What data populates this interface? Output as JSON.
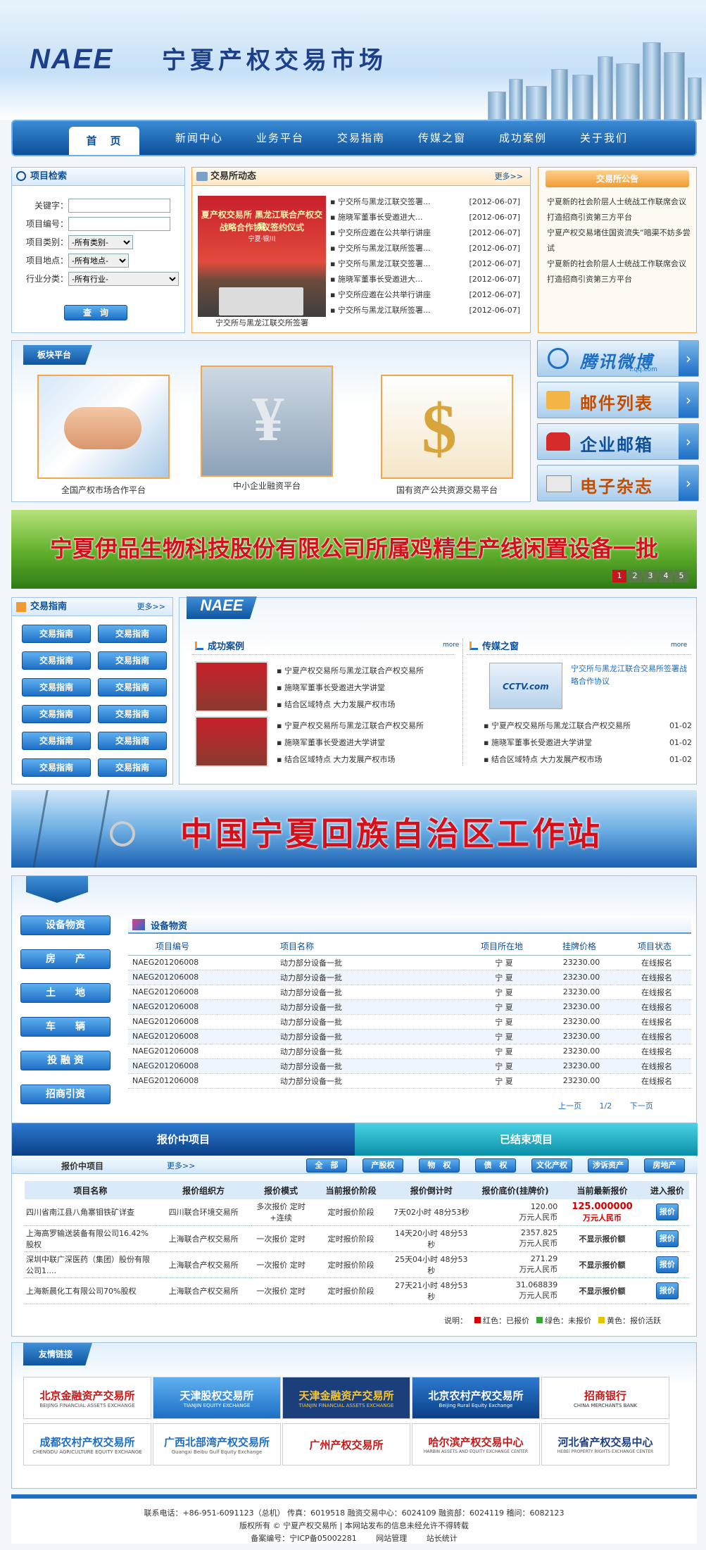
{
  "header": {
    "logo": "NAEE",
    "site_name": "宁夏产权交易市场"
  },
  "nav": {
    "items": [
      "首　页",
      "新闻中心",
      "业务平台",
      "交易指南",
      "传媒之窗",
      "成功案例",
      "关于我们"
    ]
  },
  "search": {
    "title": "项目检索",
    "fields": [
      {
        "label": "关键字：",
        "value": ""
      },
      {
        "label": "项目编号：",
        "value": ""
      },
      {
        "label": "项目类别：",
        "value": "-所有类别-"
      },
      {
        "label": "项目地点：",
        "value": "-所有地点-"
      },
      {
        "label": "行业分类：",
        "value": "-所有行业-"
      }
    ],
    "button": "查　询"
  },
  "news": {
    "title": "交易所动态",
    "more": "更多>>",
    "banner_title": "夏产权交易所  黑龙江联合产权交易",
    "banner_subtitle": "战略合作协议签约仪式",
    "banner_place": "宁夏·银川",
    "caption": "宁交所与黑龙江联交所签署",
    "items": [
      {
        "text": "宁交所与黑龙江联交签署...",
        "date": "[2012-06-07]"
      },
      {
        "text": "施晓军董事长受邀进大...",
        "date": "[2012-06-07]"
      },
      {
        "text": "宁交所应邀在公共举行讲座",
        "date": "[2012-06-07]"
      },
      {
        "text": "宁交所与黑龙江联所签署...",
        "date": "[2012-06-07]"
      },
      {
        "text": "宁交所与黑龙江联交签署...",
        "date": "[2012-06-07]"
      },
      {
        "text": "施晓军董事长受邀进大...",
        "date": "[2012-06-07]"
      },
      {
        "text": "宁交所应邀在公共举行讲座",
        "date": "[2012-06-07]"
      },
      {
        "text": "宁交所与黑龙江联所签署...",
        "date": "[2012-06-07]"
      }
    ]
  },
  "notice": {
    "title": "交易所公告",
    "items": [
      "宁夏新的社会阶层人士统战工作联席会议",
      "打造招商引资第三方平台",
      "宁夏产权交易堵住国资流失“暗渠不妨多尝试",
      "宁夏新的社会阶层人士统战工作联席会议",
      "打造招商引资第三方平台"
    ]
  },
  "platform": {
    "title": "板块平台",
    "items": [
      "全国产权市场合作平台",
      "中小企业融资平台",
      "国有资产公共资源交易平台"
    ]
  },
  "side_buttons": [
    {
      "label": "腾讯微博",
      "sub": "t.qq.com"
    },
    {
      "label": "邮件列表",
      "sub": ""
    },
    {
      "label": "企业邮箱",
      "sub": ""
    },
    {
      "label": "电子杂志",
      "sub": ""
    }
  ],
  "banner": {
    "text": "宁夏伊品生物科技股份有限公司所属鸡精生产线闲置设备一批",
    "pages": [
      "1",
      "2",
      "3",
      "4",
      "5"
    ]
  },
  "guide": {
    "title": "交易指南",
    "more": "更多>>",
    "buttons": [
      "交易指南",
      "交易指南",
      "交易指南",
      "交易指南",
      "交易指南",
      "交易指南",
      "交易指南",
      "交易指南",
      "交易指南",
      "交易指南",
      "交易指南",
      "交易指南"
    ]
  },
  "success": {
    "title": "成功案例",
    "more": "more",
    "items": [
      "宁夏产权交易所与黑龙江联合产权交易所",
      "施晓军董事长受邀进大学讲堂",
      "结合区域特点 大力发展产权市场",
      "宁夏产权交易所与黑龙江联合产权交易所",
      "施晓军董事长受邀进大学讲堂",
      "结合区域特点 大力发展产权市场"
    ]
  },
  "media": {
    "title": "传媒之窗",
    "more": "more",
    "feature": "宁交所与黑龙江联合交易所签署战略合作协议",
    "thumb_label": "CCTV.com",
    "items": [
      {
        "text": "宁夏产权交易所与黑龙江联合产权交易所",
        "date": "01-02"
      },
      {
        "text": "施晓军董事长受邀进大学讲堂",
        "date": "01-02"
      },
      {
        "text": "结合区域特点 大力发展产权市场",
        "date": "01-02"
      }
    ]
  },
  "station": {
    "text": "中国宁夏回族自治区工作站"
  },
  "categories": [
    "设备物资",
    "房　　产",
    "土　　地",
    "车　　辆",
    "投 融 资",
    "招商引资"
  ],
  "equipment": {
    "title": "设备物资",
    "headers": [
      "项目编号",
      "项目名称",
      "项目所在地",
      "挂牌价格",
      "项目状态"
    ],
    "rows": [
      [
        "NAEG201206008",
        "动力部分设备一批",
        "宁 夏",
        "23230.00",
        "在线报名"
      ],
      [
        "NAEG201206008",
        "动力部分设备一批",
        "宁 夏",
        "23230.00",
        "在线报名"
      ],
      [
        "NAEG201206008",
        "动力部分设备一批",
        "宁 夏",
        "23230.00",
        "在线报名"
      ],
      [
        "NAEG201206008",
        "动力部分设备一批",
        "宁 夏",
        "23230.00",
        "在线报名"
      ],
      [
        "NAEG201206008",
        "动力部分设备一批",
        "宁 夏",
        "23230.00",
        "在线报名"
      ],
      [
        "NAEG201206008",
        "动力部分设备一批",
        "宁 夏",
        "23230.00",
        "在线报名"
      ],
      [
        "NAEG201206008",
        "动力部分设备一批",
        "宁 夏",
        "23230.00",
        "在线报名"
      ],
      [
        "NAEG201206008",
        "动力部分设备一批",
        "宁 夏",
        "23230.00",
        "在线报名"
      ],
      [
        "NAEG201206008",
        "动力部分设备一批",
        "宁 夏",
        "23230.00",
        "在线报名"
      ]
    ],
    "pager": {
      "prev": "上一页",
      "page": "1/2",
      "next": "下一页"
    }
  },
  "quote": {
    "tab_active": "报价中项目",
    "tab_inactive": "已结束项目",
    "sub_label": "报价中项目",
    "more": "更多>>",
    "filters": [
      "全　部",
      "产股权",
      "物　权",
      "债　权",
      "文化产权",
      "涉诉资产",
      "房地产"
    ],
    "headers": [
      "项目名称",
      "报价组织方",
      "报价模式",
      "当前报价阶段",
      "报价倒计时",
      "报价底价(挂牌价)",
      "当前最新报价",
      "进入报价"
    ],
    "rows": [
      {
        "name": "四川省南江县八角寨钼铁矿详查",
        "org": "四川联合环境交易所",
        "mode": "多次报价 定时+连续",
        "stage": "定时报价阶段",
        "countdown": "7天02小时 48分53秒",
        "price": "120.00",
        "unit": "万元人民币",
        "latest": "125.000000",
        "latest_unit": "万元人民币",
        "btn": "报价"
      },
      {
        "name": "上海高罗输送装备有限公司16.42%股权",
        "org": "上海联合产权交易所",
        "mode": "一次报价 定时",
        "stage": "定时报价阶段",
        "countdown": "14天20小时 48分53秒",
        "price": "2357.825",
        "unit": "万元人民币",
        "latest": "不显示报价额",
        "latest_unit": "",
        "btn": "报价"
      },
      {
        "name": "深圳中联广深医药（集团）股份有限公司1....",
        "org": "上海联合产权交易所",
        "mode": "一次报价 定时",
        "stage": "定时报价阶段",
        "countdown": "25天04小时 48分53秒",
        "price": "271.29",
        "unit": "万元人民币",
        "latest": "不显示报价额",
        "latest_unit": "",
        "btn": "报价"
      },
      {
        "name": "上海新晨化工有限公司70%股权",
        "org": "上海联合产权交易所",
        "mode": "一次报价 定时",
        "stage": "定时报价阶段",
        "countdown": "27天21小时 48分53秒",
        "price": "31.068839",
        "unit": "万元人民币",
        "latest": "不显示报价额",
        "latest_unit": "",
        "btn": "报价"
      }
    ],
    "legend": {
      "prefix": "说明：",
      "red": "红色：已报价",
      "green": "绿色：未报价",
      "yellow": "黄色：报价活跃"
    }
  },
  "links": {
    "title": "友情链接",
    "items": [
      {
        "cn": "北京金融资产交易所",
        "en": "BEIJING FINANCIAL ASSETS EXCHANGE"
      },
      {
        "cn": "天津股权交易所",
        "en": "TIANJIN EQUITY EXCHANGE"
      },
      {
        "cn": "天津金融资产交易所",
        "en": "TIANJIN FINANCIAL ASSETS EXCHANGE"
      },
      {
        "cn": "北京农村产权交易所",
        "en": "Beijing Rural Equity Exchange"
      },
      {
        "cn": "招商银行",
        "en": "CHINA MERCHANTS BANK"
      },
      {
        "cn": "成都农村产权交易所",
        "en": "CHENGDU AGRICULTURE EQUITY EXCHANGE"
      },
      {
        "cn": "广西北部湾产权交易所",
        "en": "Guangxi Beibu Gulf Equity Exchange"
      },
      {
        "cn": "广州产权交易所",
        "en": ""
      },
      {
        "cn": "哈尔滨产权交易中心",
        "en": "HARBIN ASSETS AND EQUITY EXCHANGE CENTER"
      },
      {
        "cn": "河北省产权交易中心",
        "en": "HEBEI PROPERTY RIGHTS EXCHANGE CENTER"
      }
    ]
  },
  "footer": {
    "line1": "联系电话：+86-951-6091123（总机）  传真：6019518  融资交易中心：6024109  融资部：6024119  稽问：6082123",
    "line2": "版权所有 © 宁夏产权交易所  |  本网站发布的信息未经允许不得转载",
    "line3_prefix": "备案编号：宁ICP备05002281",
    "admin": "网站管理",
    "stats": "站长统计"
  },
  "colors": {
    "brand": "#1c3f8a",
    "nav": "#0d4f9a",
    "red": "#d40000",
    "orange": "#f4a64a"
  }
}
